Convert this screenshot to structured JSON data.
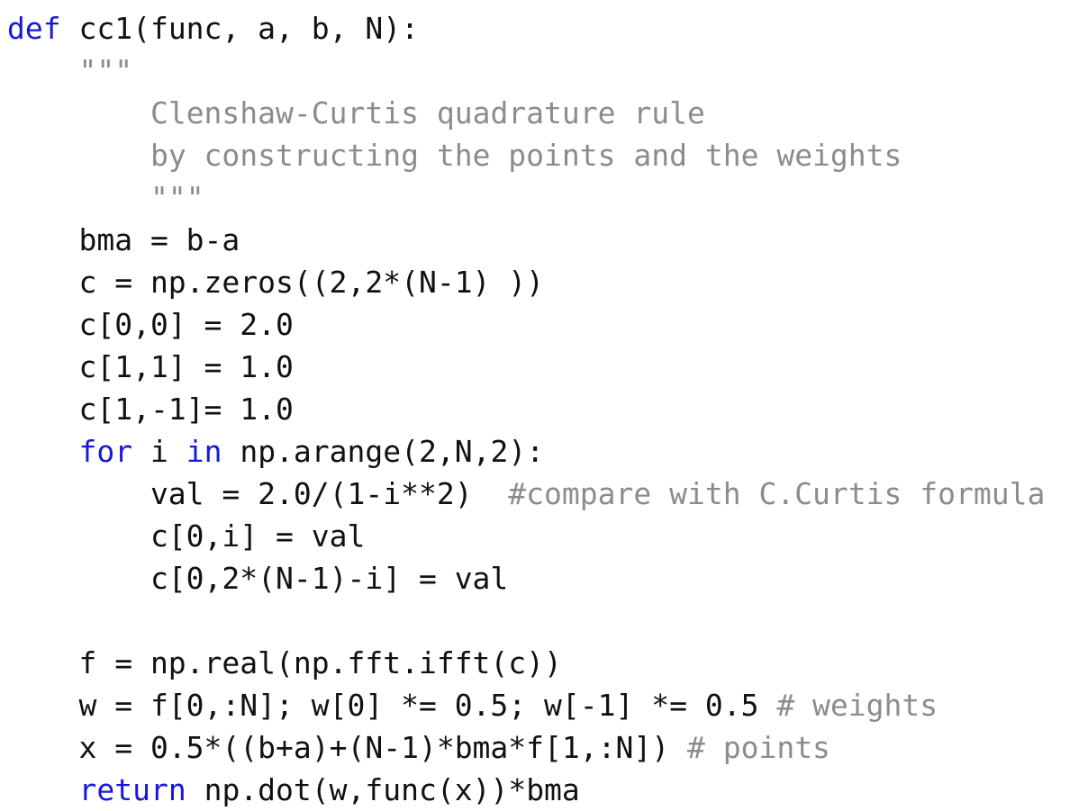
{
  "code_lines": [
    [
      {
        "k": "kw",
        "t": "def"
      },
      {
        "k": "plain",
        "t": " cc1(func, a, b, N):"
      }
    ],
    [
      {
        "k": "plain",
        "t": "    "
      },
      {
        "k": "doc",
        "t": "\"\"\""
      }
    ],
    [
      {
        "k": "plain",
        "t": "        "
      },
      {
        "k": "doc",
        "t": "Clenshaw-Curtis quadrature rule"
      }
    ],
    [
      {
        "k": "plain",
        "t": "        "
      },
      {
        "k": "doc",
        "t": "by constructing the points and the weights"
      }
    ],
    [
      {
        "k": "plain",
        "t": "        "
      },
      {
        "k": "doc",
        "t": "\"\"\""
      }
    ],
    [
      {
        "k": "plain",
        "t": "    bma = b-a"
      }
    ],
    [
      {
        "k": "plain",
        "t": "    c = np.zeros((2,2*(N-1) ))"
      }
    ],
    [
      {
        "k": "plain",
        "t": "    c[0,0] = 2.0"
      }
    ],
    [
      {
        "k": "plain",
        "t": "    c[1,1] = 1.0"
      }
    ],
    [
      {
        "k": "plain",
        "t": "    c[1,-1]= 1.0"
      }
    ],
    [
      {
        "k": "plain",
        "t": "    "
      },
      {
        "k": "kw",
        "t": "for"
      },
      {
        "k": "plain",
        "t": " i "
      },
      {
        "k": "kw",
        "t": "in"
      },
      {
        "k": "plain",
        "t": " np.arange(2,N,2):"
      }
    ],
    [
      {
        "k": "plain",
        "t": "        val = 2.0/(1-i**2)  "
      },
      {
        "k": "cm",
        "t": "#compare with C.Curtis formula"
      }
    ],
    [
      {
        "k": "plain",
        "t": "        c[0,i] = val"
      }
    ],
    [
      {
        "k": "plain",
        "t": "        c[0,2*(N-1)-i] = val"
      }
    ],
    [
      {
        "k": "plain",
        "t": ""
      }
    ],
    [
      {
        "k": "plain",
        "t": "    f = np.real(np.fft.ifft(c))"
      }
    ],
    [
      {
        "k": "plain",
        "t": "    w = f[0,:N]; w[0] *= 0.5; w[-1] *= 0.5 "
      },
      {
        "k": "cm",
        "t": "# weights"
      }
    ],
    [
      {
        "k": "plain",
        "t": "    x = 0.5*((b+a)+(N-1)*bma*f[1,:N]) "
      },
      {
        "k": "cm",
        "t": "# points"
      }
    ],
    [
      {
        "k": "plain",
        "t": "    "
      },
      {
        "k": "kw",
        "t": "return"
      },
      {
        "k": "plain",
        "t": " np.dot(w,func(x))*bma"
      }
    ]
  ],
  "colors": {
    "keyword": "#1818d8",
    "docstring": "#8c8c8c",
    "comment": "#8c8c8c",
    "text": "#111111",
    "background": "#ffffff"
  }
}
